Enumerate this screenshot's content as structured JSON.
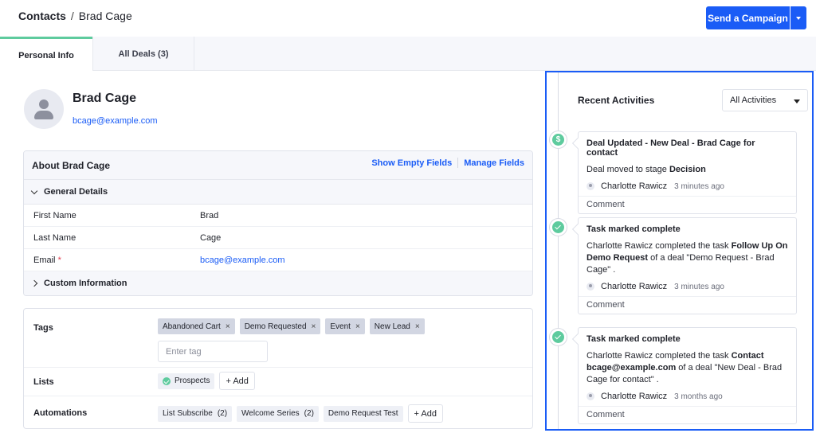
{
  "breadcrumb": {
    "root": "Contacts",
    "separator": "/",
    "current": "Brad Cage"
  },
  "header": {
    "send_campaign_label": "Send a Campaign"
  },
  "tabs": [
    {
      "label": "Personal Info",
      "active": true
    },
    {
      "label": "All Deals (3)",
      "active": false
    }
  ],
  "profile": {
    "name": "Brad Cage",
    "email": "bcage@example.com"
  },
  "about": {
    "title": "About Brad Cage",
    "show_empty_fields": "Show Empty Fields",
    "manage_fields": "Manage Fields",
    "general_details": "General Details",
    "fields": [
      {
        "label": "First Name",
        "value": "Brad",
        "required": false
      },
      {
        "label": "Last Name",
        "value": "Cage",
        "required": false
      },
      {
        "label": "Email",
        "value": "bcage@example.com",
        "required": true,
        "required_mark": "*"
      }
    ],
    "custom_information": "Custom Information"
  },
  "meta": {
    "tags_label": "Tags",
    "tags": [
      "Abandoned Cart",
      "Demo Requested",
      "Event",
      "New Lead"
    ],
    "tag_remove_glyph": "×",
    "tag_input_placeholder": "Enter tag",
    "lists_label": "Lists",
    "lists": [
      "Prospects"
    ],
    "add_label": "+ Add",
    "automations_label": "Automations",
    "automations": [
      {
        "name": "List Subscribe",
        "count": "(2)"
      },
      {
        "name": "Welcome Series",
        "count": "(2)"
      },
      {
        "name": "Demo Request Test",
        "count": ""
      }
    ]
  },
  "activities": {
    "title": "Recent Activities",
    "filter_value": "All Activities",
    "comment_label": "Comment",
    "items": [
      {
        "icon": "dollar-icon",
        "icon_glyph": "$",
        "title": "Deal Updated - New Deal - Brad Cage for contact",
        "body_parts": [
          {
            "text": "Deal moved to stage ",
            "bold": false
          },
          {
            "text": "Decision",
            "bold": true
          }
        ],
        "user": "Charlotte Rawicz",
        "time": "3 minutes ago"
      },
      {
        "icon": "check-icon",
        "title": "Task marked complete",
        "body_parts": [
          {
            "text": "Charlotte Rawicz completed the task ",
            "bold": false
          },
          {
            "text": "Follow Up On Demo Request",
            "bold": true
          },
          {
            "text": " of a deal \"Demo Request - Brad Cage\" .",
            "bold": false
          }
        ],
        "user": "Charlotte Rawicz",
        "time": "3 minutes ago"
      },
      {
        "icon": "check-icon",
        "title": "Task marked complete",
        "body_parts": [
          {
            "text": "Charlotte Rawicz completed the task ",
            "bold": false
          },
          {
            "text": "Contact bcage@example.com",
            "bold": true
          },
          {
            "text": " of a deal \"New Deal - Brad Cage for contact\" .",
            "bold": false
          }
        ],
        "user": "Charlotte Rawicz",
        "time": "3 months ago"
      }
    ]
  },
  "colors": {
    "primary": "#1a5cf6",
    "accent_green": "#5ecb9e",
    "required_red": "#e0364a"
  }
}
